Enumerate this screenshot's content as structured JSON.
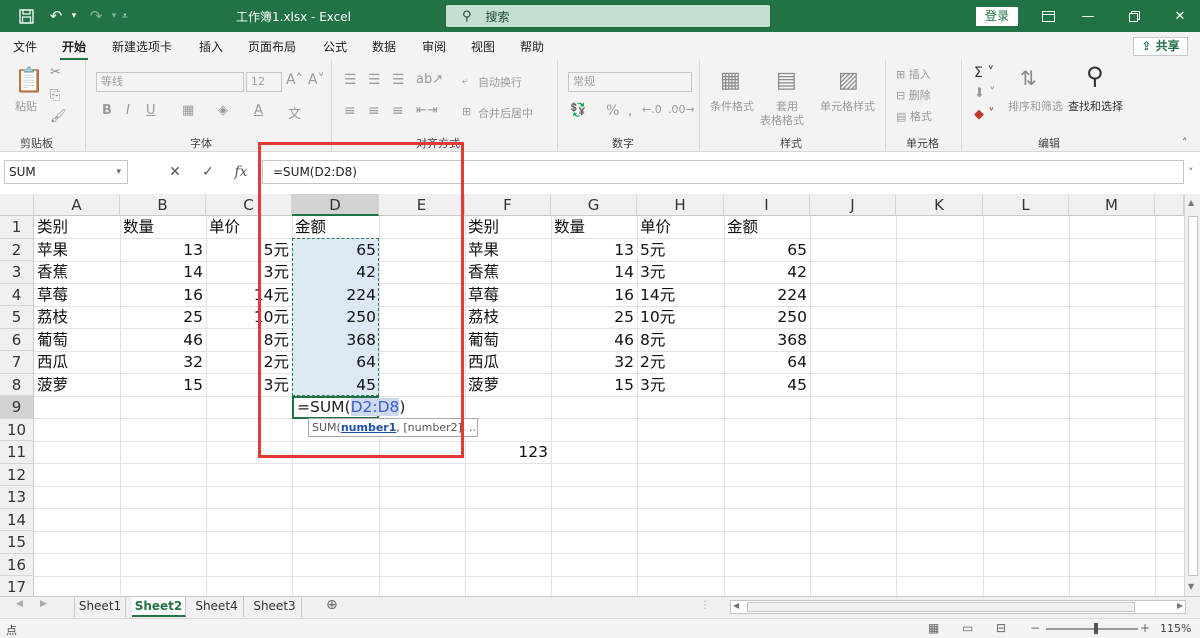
{
  "titlebar": {
    "file_title": "工作簿1.xlsx  -  Excel",
    "search_placeholder": "搜索",
    "login_label": "登录"
  },
  "menu": {
    "items": [
      "文件",
      "开始",
      "新建选项卡",
      "插入",
      "页面布局",
      "公式",
      "数据",
      "审阅",
      "视图",
      "帮助"
    ],
    "active": "开始",
    "share_label": "共享"
  },
  "ribbon": {
    "paste_label": "粘贴",
    "clipboard_group": "剪贴板",
    "font_name": "等线",
    "font_size": "12",
    "font_group": "字体",
    "wrap_text": "自动换行",
    "merge_center": "合并后居中",
    "alignment_group": "对齐方式",
    "number_format": "常规",
    "number_group": "数字",
    "conditional_format": "条件格式",
    "format_as_table_1": "套用",
    "format_as_table_2": "表格格式",
    "cell_styles": "单元格样式",
    "styles_group": "样式",
    "insert": "插入",
    "delete": "删除",
    "format": "格式",
    "cells_group": "单元格",
    "sort_filter": "排序和筛选",
    "find_select": "查找和选择",
    "editing_group": "编辑"
  },
  "formula_bar": {
    "name_box": "SUM",
    "cancel_icon": "✕",
    "enter_icon": "✓",
    "fx_label": "fx",
    "formula": "=SUM(D2:D8)"
  },
  "grid": {
    "columns": [
      "A",
      "B",
      "C",
      "D",
      "E",
      "F",
      "G",
      "H",
      "I",
      "J",
      "K",
      "L",
      "M"
    ],
    "selected_column": "D",
    "rows": [
      "1",
      "2",
      "3",
      "4",
      "5",
      "6",
      "7",
      "8",
      "9",
      "10",
      "11",
      "12",
      "13",
      "14",
      "15",
      "16",
      "17"
    ],
    "selected_row": "9",
    "left_table": {
      "headers": [
        "类别",
        "数量",
        "单价",
        "金额"
      ],
      "rows": [
        [
          "苹果",
          "13",
          "5元",
          "65"
        ],
        [
          "香蕉",
          "14",
          "3元",
          "42"
        ],
        [
          "草莓",
          "16",
          "14元",
          "224"
        ],
        [
          "荔枝",
          "25",
          "10元",
          "250"
        ],
        [
          "葡萄",
          "46",
          "8元",
          "368"
        ],
        [
          "西瓜",
          "32",
          "2元",
          "64"
        ],
        [
          "菠萝",
          "15",
          "3元",
          "45"
        ]
      ]
    },
    "right_table": {
      "headers": [
        "类别",
        "数量",
        "单价",
        "金额"
      ],
      "rows": [
        [
          "苹果",
          "13",
          "5元",
          "65"
        ],
        [
          "香蕉",
          "14",
          "3元",
          "42"
        ],
        [
          "草莓",
          "16",
          "14元",
          "224"
        ],
        [
          "荔枝",
          "25",
          "10元",
          "250"
        ],
        [
          "葡萄",
          "46",
          "8元",
          "368"
        ],
        [
          "西瓜",
          "32",
          "2元",
          "64"
        ],
        [
          "菠萝",
          "15",
          "3元",
          "45"
        ]
      ]
    },
    "edit_prefix": "=SUM(",
    "edit_ref": "D2:D8",
    "edit_suffix": ")",
    "tooltip_fn": "SUM(",
    "tooltip_arg1": "number1",
    "tooltip_rest": ", [number2], ...)",
    "f11_value": "123"
  },
  "sheets": {
    "tabs": [
      "Sheet1",
      "Sheet2",
      "Sheet4",
      "Sheet3"
    ],
    "active": "Sheet2"
  },
  "status": {
    "mode": "点",
    "zoom": "115%"
  },
  "colors": {
    "accent": "#217346",
    "highlight_box": "#e53935",
    "selection_fill": "#dde8f5"
  }
}
